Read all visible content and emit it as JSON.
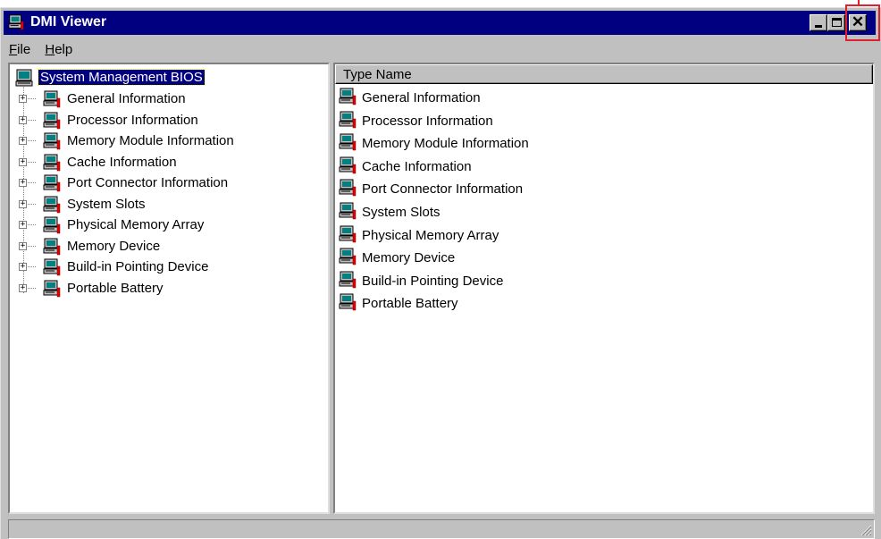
{
  "window": {
    "title": "DMI Viewer",
    "icon": "computer-icon"
  },
  "menu": [
    {
      "label": "File",
      "accel": "F",
      "rest": "ile"
    },
    {
      "label": "Help",
      "accel": "H",
      "rest": "elp"
    }
  ],
  "tree": {
    "root": {
      "label": "System Management BIOS",
      "icon": "computer-icon",
      "selected": true
    },
    "items": [
      {
        "label": "General Information",
        "expander": "+"
      },
      {
        "label": "Processor Information",
        "expander": "+"
      },
      {
        "label": "Memory Module Information",
        "expander": "+"
      },
      {
        "label": "Cache Information",
        "expander": "+"
      },
      {
        "label": "Port Connector Information",
        "expander": "+"
      },
      {
        "label": "System Slots",
        "expander": "+"
      },
      {
        "label": "Physical Memory Array",
        "expander": "+"
      },
      {
        "label": "Memory Device",
        "expander": "+"
      },
      {
        "label": "Build-in Pointing Device",
        "expander": "+"
      },
      {
        "label": "Portable Battery",
        "expander": "+"
      }
    ]
  },
  "list": {
    "column_header": "Type Name",
    "items": [
      "General Information",
      "Processor Information",
      "Memory Module Information",
      "Cache Information",
      "Port Connector Information",
      "System Slots",
      "Physical Memory Array",
      "Memory Device",
      "Build-in Pointing Device",
      "Portable Battery"
    ]
  },
  "statusbar": {
    "text": ""
  },
  "colors": {
    "titlebar": "#000080",
    "face": "#c0c0c0",
    "highlight": "#e0202c"
  }
}
